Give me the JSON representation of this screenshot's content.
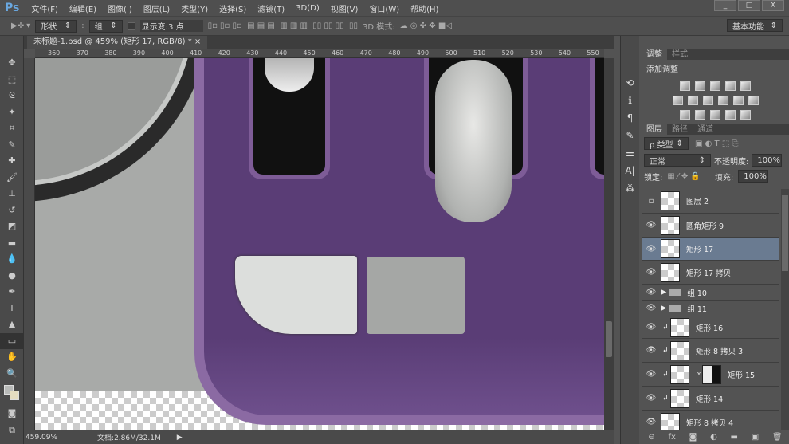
{
  "app": {
    "logo": "Ps"
  },
  "menu": [
    "文件(F)",
    "编辑(E)",
    "图像(I)",
    "图层(L)",
    "类型(Y)",
    "选择(S)",
    "滤镜(T)",
    "3D(D)",
    "视图(V)",
    "窗口(W)",
    "帮助(H)"
  ],
  "window_controls": [
    "_",
    "□",
    "X"
  ],
  "options": {
    "mode": "形状",
    "group": "组",
    "show_transform": "显示变:3 点",
    "mode3d": "3D 模式:",
    "workspace": "基本功能"
  },
  "document": {
    "tab": "未标题-1.psd @ 459% (矩形 17, RGB/8) *"
  },
  "ruler_ticks": [
    "360",
    "370",
    "380",
    "390",
    "400",
    "410",
    "420",
    "430",
    "440",
    "450",
    "460",
    "470",
    "480",
    "490",
    "500",
    "510",
    "520",
    "530",
    "540",
    "550"
  ],
  "status": {
    "zoom": "459.09%",
    "doc": "文档:2.86M/32.1M"
  },
  "adjustments": {
    "tabs": [
      "调整",
      "样式"
    ],
    "title": "添加调整"
  },
  "layers_panel": {
    "tabs": [
      "图层",
      "路径",
      "通道"
    ],
    "filter": "ρ 类型",
    "blend": "正常",
    "opacity_label": "不透明度:",
    "opacity": "100%",
    "lock_label": "锁定:",
    "fill_label": "填充:",
    "fill": "100%",
    "layers": [
      {
        "name": "图层 2",
        "visible": false
      },
      {
        "name": "圆角矩形 9",
        "visible": true
      },
      {
        "name": "矩形 17",
        "visible": true,
        "selected": true
      },
      {
        "name": "矩形 17 拷贝",
        "visible": true
      },
      {
        "name": "组 10",
        "visible": true,
        "group": true
      },
      {
        "name": "组 11",
        "visible": true,
        "group": true
      },
      {
        "name": "矩形 16",
        "visible": true,
        "clipped": true
      },
      {
        "name": "矩形 8 拷贝 3",
        "visible": true,
        "clipped": true
      },
      {
        "name": "矩形 15",
        "visible": true,
        "clipped": true,
        "mask": true
      },
      {
        "name": "矩形 14",
        "visible": true,
        "clipped": true
      },
      {
        "name": "矩形 8 拷贝 4",
        "visible": true
      }
    ],
    "footer_icons": [
      "link-icon",
      "fx-icon",
      "mask-icon",
      "adjustment-icon",
      "folder-icon",
      "new-layer-icon",
      "trash-icon"
    ]
  },
  "colors": {
    "purple": "#5c3f78",
    "selection": "#6a7b91"
  }
}
